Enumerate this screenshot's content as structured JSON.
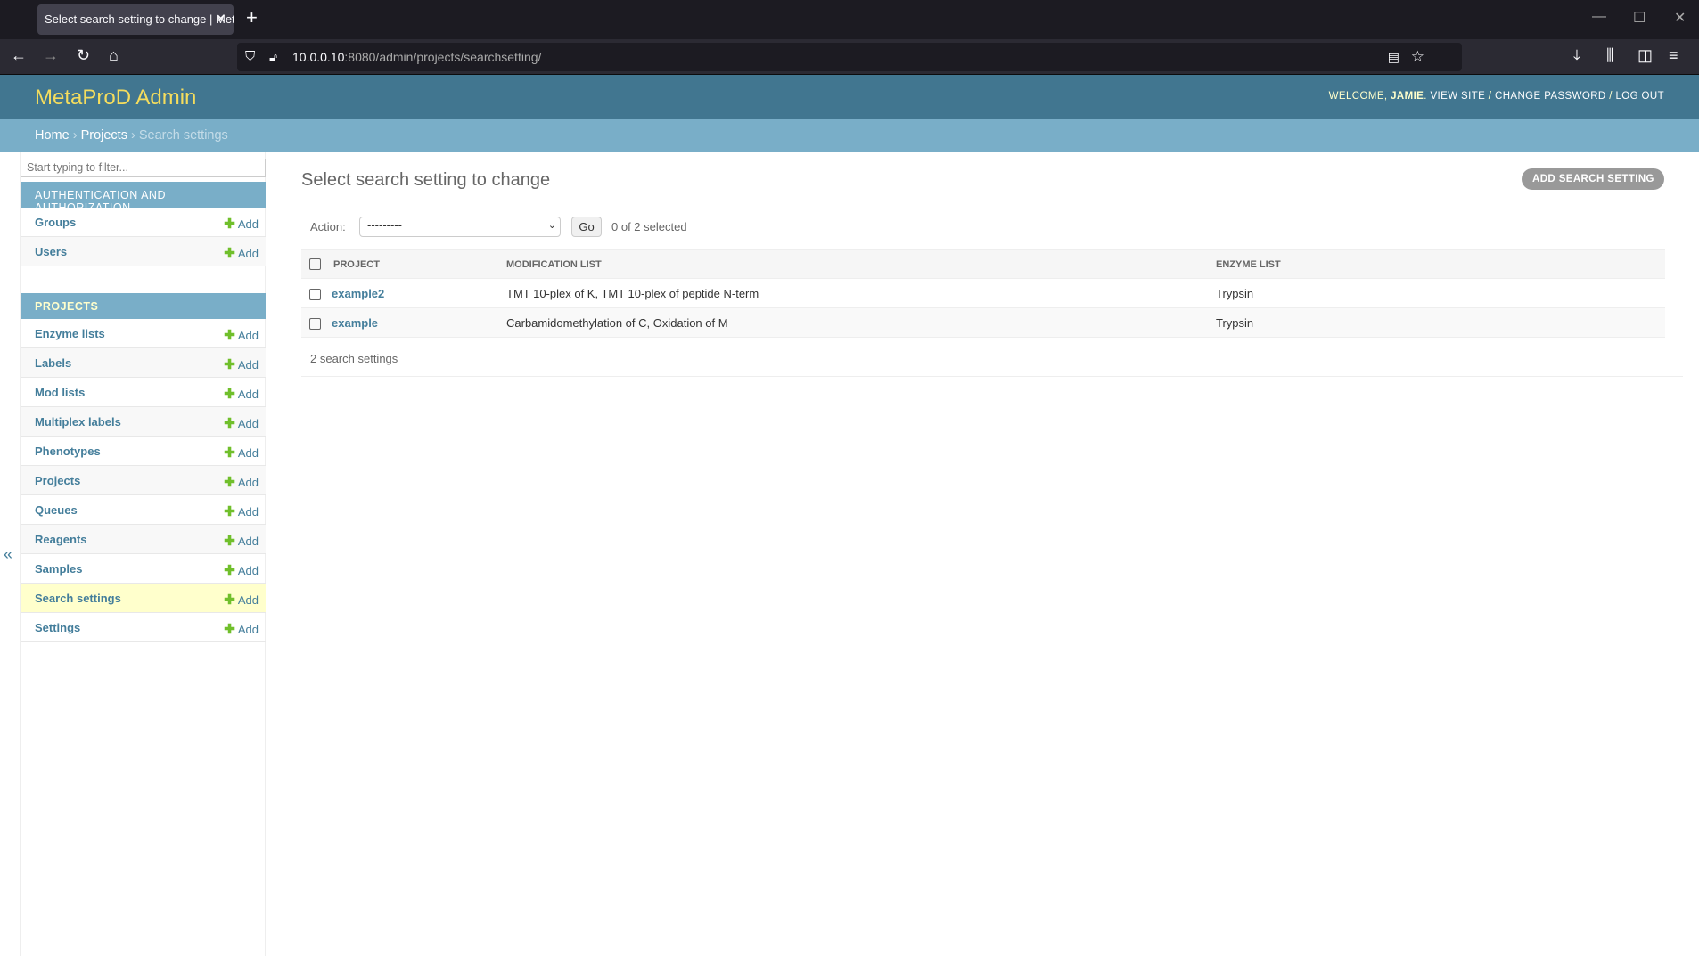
{
  "browser": {
    "tab_title": "Select search setting to change | MetaProD Admin",
    "url_host": "10.0.0.10",
    "url_rest": ":8080/admin/projects/searchsetting/"
  },
  "header": {
    "brand": "MetaProD Admin",
    "welcome": "WELCOME, ",
    "user": "JAMIE",
    "view_site": "VIEW SITE",
    "change_password": "CHANGE PASSWORD",
    "log_out": "LOG OUT"
  },
  "breadcrumbs": {
    "home": "Home",
    "projects": "Projects",
    "current": "Search settings"
  },
  "sidebar": {
    "filter_placeholder": "Start typing to filter...",
    "add_label": "Add",
    "auth": {
      "title": "AUTHENTICATION AND AUTHORIZATION",
      "items": [
        "Groups",
        "Users"
      ]
    },
    "projects": {
      "title": "PROJECTS",
      "items": [
        "Enzyme lists",
        "Labels",
        "Mod lists",
        "Multiplex labels",
        "Phenotypes",
        "Projects",
        "Queues",
        "Reagents",
        "Samples",
        "Search settings",
        "Settings"
      ],
      "selected": "Search settings"
    }
  },
  "main": {
    "title": "Select search setting to change",
    "add_button": "ADD SEARCH SETTING",
    "action_label": "Action:",
    "action_value": "---------",
    "go": "Go",
    "selected_count": "0 of 2 selected",
    "columns": [
      "PROJECT",
      "MODIFICATION LIST",
      "ENZYME LIST"
    ],
    "rows": [
      {
        "project": "example2",
        "mods": "TMT 10-plex of K, TMT 10-plex of peptide N-term",
        "enzyme": "Trypsin"
      },
      {
        "project": "example",
        "mods": "Carbamidomethylation of C, Oxidation of M",
        "enzyme": "Trypsin"
      }
    ],
    "footer": "2 search settings"
  },
  "colors": {
    "header": "#417690",
    "breadcrumbs": "#79aec8",
    "brand": "#f5dd5d",
    "link": "#447e9b",
    "add_green": "#70bf2b",
    "selected_row": "#ffffcc"
  }
}
